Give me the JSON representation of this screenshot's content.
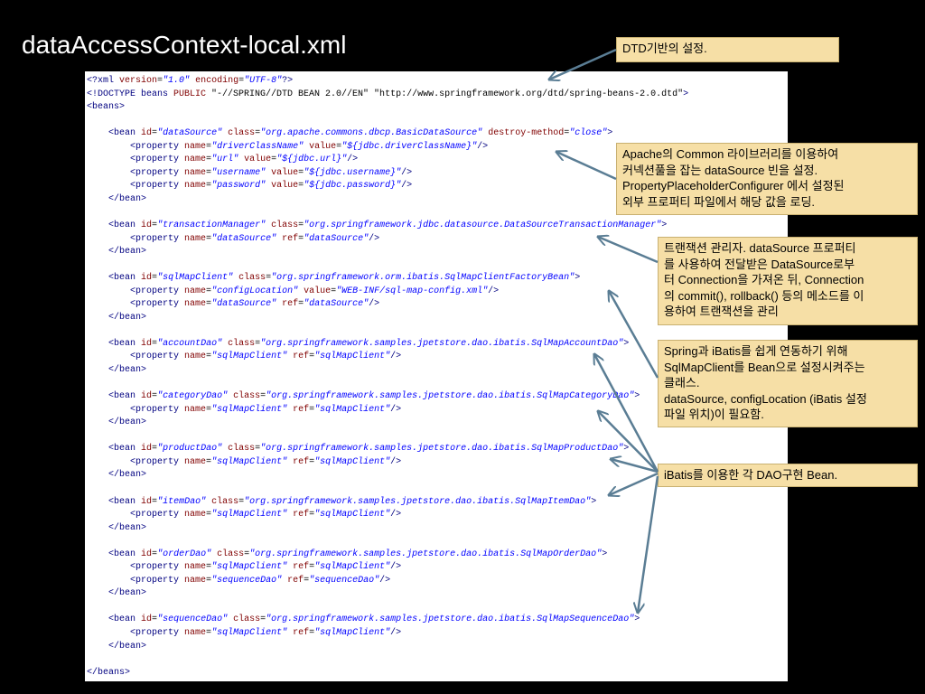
{
  "slide": {
    "title": "dataAccessContext-local.xml"
  },
  "code_lines": [
    [
      [
        "tag",
        "<?xml "
      ],
      [
        "attr",
        "version"
      ],
      [
        "plain",
        "="
      ],
      [
        "val",
        "\"1.0\""
      ],
      [
        "plain",
        " "
      ],
      [
        "attr",
        "encoding"
      ],
      [
        "plain",
        "="
      ],
      [
        "val",
        "\"UTF-8\""
      ],
      [
        "tag",
        "?>"
      ]
    ],
    [
      [
        "tag",
        "<!DOCTYPE beans "
      ],
      [
        "attr",
        "PUBLIC "
      ],
      [
        "plain",
        "\"-//SPRING//DTD BEAN 2.0//EN\" \"http://www.springframework.org/dtd/spring-beans-2.0.dtd\""
      ],
      [
        "tag",
        ">"
      ]
    ],
    [
      [
        "tag",
        "<beans>"
      ]
    ],
    [],
    [
      [
        "plain",
        "    "
      ],
      [
        "tag",
        "<bean "
      ],
      [
        "attr",
        "id"
      ],
      [
        "plain",
        "="
      ],
      [
        "val",
        "\"dataSource\""
      ],
      [
        "plain",
        " "
      ],
      [
        "attr",
        "class"
      ],
      [
        "plain",
        "="
      ],
      [
        "val",
        "\"org.apache.commons.dbcp.BasicDataSource\""
      ],
      [
        "plain",
        " "
      ],
      [
        "attr",
        "destroy-method"
      ],
      [
        "plain",
        "="
      ],
      [
        "val",
        "\"close\""
      ],
      [
        "tag",
        ">"
      ]
    ],
    [
      [
        "plain",
        "        "
      ],
      [
        "tag",
        "<property "
      ],
      [
        "attr",
        "name"
      ],
      [
        "plain",
        "="
      ],
      [
        "val",
        "\"driverClassName\""
      ],
      [
        "plain",
        " "
      ],
      [
        "attr",
        "value"
      ],
      [
        "plain",
        "="
      ],
      [
        "val",
        "\"${jdbc.driverClassName}\""
      ],
      [
        "tag",
        "/>"
      ]
    ],
    [
      [
        "plain",
        "        "
      ],
      [
        "tag",
        "<property "
      ],
      [
        "attr",
        "name"
      ],
      [
        "plain",
        "="
      ],
      [
        "val",
        "\"url\""
      ],
      [
        "plain",
        " "
      ],
      [
        "attr",
        "value"
      ],
      [
        "plain",
        "="
      ],
      [
        "val",
        "\"${jdbc.url}\""
      ],
      [
        "tag",
        "/>"
      ]
    ],
    [
      [
        "plain",
        "        "
      ],
      [
        "tag",
        "<property "
      ],
      [
        "attr",
        "name"
      ],
      [
        "plain",
        "="
      ],
      [
        "val",
        "\"username\""
      ],
      [
        "plain",
        " "
      ],
      [
        "attr",
        "value"
      ],
      [
        "plain",
        "="
      ],
      [
        "val",
        "\"${jdbc.username}\""
      ],
      [
        "tag",
        "/>"
      ]
    ],
    [
      [
        "plain",
        "        "
      ],
      [
        "tag",
        "<property "
      ],
      [
        "attr",
        "name"
      ],
      [
        "plain",
        "="
      ],
      [
        "val",
        "\"password\""
      ],
      [
        "plain",
        " "
      ],
      [
        "attr",
        "value"
      ],
      [
        "plain",
        "="
      ],
      [
        "val",
        "\"${jdbc.password}\""
      ],
      [
        "tag",
        "/>"
      ]
    ],
    [
      [
        "plain",
        "    "
      ],
      [
        "tag",
        "</bean>"
      ]
    ],
    [],
    [
      [
        "plain",
        "    "
      ],
      [
        "tag",
        "<bean "
      ],
      [
        "attr",
        "id"
      ],
      [
        "plain",
        "="
      ],
      [
        "val",
        "\"transactionManager\""
      ],
      [
        "plain",
        " "
      ],
      [
        "attr",
        "class"
      ],
      [
        "plain",
        "="
      ],
      [
        "val",
        "\"org.springframework.jdbc.datasource.DataSourceTransactionManager\""
      ],
      [
        "tag",
        ">"
      ]
    ],
    [
      [
        "plain",
        "        "
      ],
      [
        "tag",
        "<property "
      ],
      [
        "attr",
        "name"
      ],
      [
        "plain",
        "="
      ],
      [
        "val",
        "\"dataSource\""
      ],
      [
        "plain",
        " "
      ],
      [
        "attr",
        "ref"
      ],
      [
        "plain",
        "="
      ],
      [
        "val",
        "\"dataSource\""
      ],
      [
        "tag",
        "/>"
      ]
    ],
    [
      [
        "plain",
        "    "
      ],
      [
        "tag",
        "</bean>"
      ]
    ],
    [],
    [
      [
        "plain",
        "    "
      ],
      [
        "tag",
        "<bean "
      ],
      [
        "attr",
        "id"
      ],
      [
        "plain",
        "="
      ],
      [
        "val",
        "\"sqlMapClient\""
      ],
      [
        "plain",
        " "
      ],
      [
        "attr",
        "class"
      ],
      [
        "plain",
        "="
      ],
      [
        "val",
        "\"org.springframework.orm.ibatis.SqlMapClientFactoryBean\""
      ],
      [
        "tag",
        ">"
      ]
    ],
    [
      [
        "plain",
        "        "
      ],
      [
        "tag",
        "<property "
      ],
      [
        "attr",
        "name"
      ],
      [
        "plain",
        "="
      ],
      [
        "val",
        "\"configLocation\""
      ],
      [
        "plain",
        " "
      ],
      [
        "attr",
        "value"
      ],
      [
        "plain",
        "="
      ],
      [
        "val",
        "\"WEB-INF/sql-map-config.xml\""
      ],
      [
        "tag",
        "/>"
      ]
    ],
    [
      [
        "plain",
        "        "
      ],
      [
        "tag",
        "<property "
      ],
      [
        "attr",
        "name"
      ],
      [
        "plain",
        "="
      ],
      [
        "val",
        "\"dataSource\""
      ],
      [
        "plain",
        " "
      ],
      [
        "attr",
        "ref"
      ],
      [
        "plain",
        "="
      ],
      [
        "val",
        "\"dataSource\""
      ],
      [
        "tag",
        "/>"
      ]
    ],
    [
      [
        "plain",
        "    "
      ],
      [
        "tag",
        "</bean>"
      ]
    ],
    [],
    [
      [
        "plain",
        "    "
      ],
      [
        "tag",
        "<bean "
      ],
      [
        "attr",
        "id"
      ],
      [
        "plain",
        "="
      ],
      [
        "val",
        "\"accountDao\""
      ],
      [
        "plain",
        " "
      ],
      [
        "attr",
        "class"
      ],
      [
        "plain",
        "="
      ],
      [
        "val",
        "\"org.springframework.samples.jpetstore.dao.ibatis.SqlMapAccountDao\""
      ],
      [
        "tag",
        ">"
      ]
    ],
    [
      [
        "plain",
        "        "
      ],
      [
        "tag",
        "<property "
      ],
      [
        "attr",
        "name"
      ],
      [
        "plain",
        "="
      ],
      [
        "val",
        "\"sqlMapClient\""
      ],
      [
        "plain",
        " "
      ],
      [
        "attr",
        "ref"
      ],
      [
        "plain",
        "="
      ],
      [
        "val",
        "\"sqlMapClient\""
      ],
      [
        "tag",
        "/>"
      ]
    ],
    [
      [
        "plain",
        "    "
      ],
      [
        "tag",
        "</bean>"
      ]
    ],
    [],
    [
      [
        "plain",
        "    "
      ],
      [
        "tag",
        "<bean "
      ],
      [
        "attr",
        "id"
      ],
      [
        "plain",
        "="
      ],
      [
        "val",
        "\"categoryDao\""
      ],
      [
        "plain",
        " "
      ],
      [
        "attr",
        "class"
      ],
      [
        "plain",
        "="
      ],
      [
        "val",
        "\"org.springframework.samples.jpetstore.dao.ibatis.SqlMapCategoryDao\""
      ],
      [
        "tag",
        ">"
      ]
    ],
    [
      [
        "plain",
        "        "
      ],
      [
        "tag",
        "<property "
      ],
      [
        "attr",
        "name"
      ],
      [
        "plain",
        "="
      ],
      [
        "val",
        "\"sqlMapClient\""
      ],
      [
        "plain",
        " "
      ],
      [
        "attr",
        "ref"
      ],
      [
        "plain",
        "="
      ],
      [
        "val",
        "\"sqlMapClient\""
      ],
      [
        "tag",
        "/>"
      ]
    ],
    [
      [
        "plain",
        "    "
      ],
      [
        "tag",
        "</bean>"
      ]
    ],
    [],
    [
      [
        "plain",
        "    "
      ],
      [
        "tag",
        "<bean "
      ],
      [
        "attr",
        "id"
      ],
      [
        "plain",
        "="
      ],
      [
        "val",
        "\"productDao\""
      ],
      [
        "plain",
        " "
      ],
      [
        "attr",
        "class"
      ],
      [
        "plain",
        "="
      ],
      [
        "val",
        "\"org.springframework.samples.jpetstore.dao.ibatis.SqlMapProductDao\""
      ],
      [
        "tag",
        ">"
      ]
    ],
    [
      [
        "plain",
        "        "
      ],
      [
        "tag",
        "<property "
      ],
      [
        "attr",
        "name"
      ],
      [
        "plain",
        "="
      ],
      [
        "val",
        "\"sqlMapClient\""
      ],
      [
        "plain",
        " "
      ],
      [
        "attr",
        "ref"
      ],
      [
        "plain",
        "="
      ],
      [
        "val",
        "\"sqlMapClient\""
      ],
      [
        "tag",
        "/>"
      ]
    ],
    [
      [
        "plain",
        "    "
      ],
      [
        "tag",
        "</bean>"
      ]
    ],
    [],
    [
      [
        "plain",
        "    "
      ],
      [
        "tag",
        "<bean "
      ],
      [
        "attr",
        "id"
      ],
      [
        "plain",
        "="
      ],
      [
        "val",
        "\"itemDao\""
      ],
      [
        "plain",
        " "
      ],
      [
        "attr",
        "class"
      ],
      [
        "plain",
        "="
      ],
      [
        "val",
        "\"org.springframework.samples.jpetstore.dao.ibatis.SqlMapItemDao\""
      ],
      [
        "tag",
        ">"
      ]
    ],
    [
      [
        "plain",
        "        "
      ],
      [
        "tag",
        "<property "
      ],
      [
        "attr",
        "name"
      ],
      [
        "plain",
        "="
      ],
      [
        "val",
        "\"sqlMapClient\""
      ],
      [
        "plain",
        " "
      ],
      [
        "attr",
        "ref"
      ],
      [
        "plain",
        "="
      ],
      [
        "val",
        "\"sqlMapClient\""
      ],
      [
        "tag",
        "/>"
      ]
    ],
    [
      [
        "plain",
        "    "
      ],
      [
        "tag",
        "</bean>"
      ]
    ],
    [],
    [
      [
        "plain",
        "    "
      ],
      [
        "tag",
        "<bean "
      ],
      [
        "attr",
        "id"
      ],
      [
        "plain",
        "="
      ],
      [
        "val",
        "\"orderDao\""
      ],
      [
        "plain",
        " "
      ],
      [
        "attr",
        "class"
      ],
      [
        "plain",
        "="
      ],
      [
        "val",
        "\"org.springframework.samples.jpetstore.dao.ibatis.SqlMapOrderDao\""
      ],
      [
        "tag",
        ">"
      ]
    ],
    [
      [
        "plain",
        "        "
      ],
      [
        "tag",
        "<property "
      ],
      [
        "attr",
        "name"
      ],
      [
        "plain",
        "="
      ],
      [
        "val",
        "\"sqlMapClient\""
      ],
      [
        "plain",
        " "
      ],
      [
        "attr",
        "ref"
      ],
      [
        "plain",
        "="
      ],
      [
        "val",
        "\"sqlMapClient\""
      ],
      [
        "tag",
        "/>"
      ]
    ],
    [
      [
        "plain",
        "        "
      ],
      [
        "tag",
        "<property "
      ],
      [
        "attr",
        "name"
      ],
      [
        "plain",
        "="
      ],
      [
        "val",
        "\"sequenceDao\""
      ],
      [
        "plain",
        " "
      ],
      [
        "attr",
        "ref"
      ],
      [
        "plain",
        "="
      ],
      [
        "val",
        "\"sequenceDao\""
      ],
      [
        "tag",
        "/>"
      ]
    ],
    [
      [
        "plain",
        "    "
      ],
      [
        "tag",
        "</bean>"
      ]
    ],
    [],
    [
      [
        "plain",
        "    "
      ],
      [
        "tag",
        "<bean "
      ],
      [
        "attr",
        "id"
      ],
      [
        "plain",
        "="
      ],
      [
        "val",
        "\"sequenceDao\""
      ],
      [
        "plain",
        " "
      ],
      [
        "attr",
        "class"
      ],
      [
        "plain",
        "="
      ],
      [
        "val",
        "\"org.springframework.samples.jpetstore.dao.ibatis.SqlMapSequenceDao\""
      ],
      [
        "tag",
        ">"
      ]
    ],
    [
      [
        "plain",
        "        "
      ],
      [
        "tag",
        "<property "
      ],
      [
        "attr",
        "name"
      ],
      [
        "plain",
        "="
      ],
      [
        "val",
        "\"sqlMapClient\""
      ],
      [
        "plain",
        " "
      ],
      [
        "attr",
        "ref"
      ],
      [
        "plain",
        "="
      ],
      [
        "val",
        "\"sqlMapClient\""
      ],
      [
        "tag",
        "/>"
      ]
    ],
    [
      [
        "plain",
        "    "
      ],
      [
        "tag",
        "</bean>"
      ]
    ],
    [],
    [
      [
        "tag",
        "</beans>"
      ]
    ]
  ],
  "callouts": {
    "dtd": {
      "lines": [
        "DTD기반의 설정."
      ]
    },
    "datasource": {
      "lines": [
        "Apache의 Common 라이브러리를 이용하여",
        "커넥션풀을 잡는 dataSource 빈을 설정.",
        "PropertyPlaceholderConfigurer 에서 설정된",
        "외부 프로퍼티 파일에서 해당 값을 로딩."
      ]
    },
    "transaction": {
      "lines": [
        "트랜잭션 관리자. dataSource 프로퍼티",
        "를 사용하여 전달받은 DataSource로부",
        "터 Connection을 가져온 뒤, Connection",
        "의 commit(), rollback() 등의 메소드를 이",
        "용하여 트랜잭션을 관리"
      ]
    },
    "sqlmap": {
      "lines": [
        "Spring과 iBatis를 쉽게 연동하기 위해",
        "SqlMapClient를 Bean으로 설정시켜주는",
        "클래스.",
        "dataSource, configLocation (iBatis 설정",
        "파일 위치)이 필요함."
      ]
    },
    "dao": {
      "lines": [
        "iBatis를 이용한 각 DAO구현 Bean."
      ]
    }
  },
  "colors": {
    "background": "#000000",
    "callout_fill": "#f6dfa6",
    "arrow": "#5a7d94",
    "xml_tag": "#000080",
    "xml_attr": "#800000",
    "xml_value": "#0000ff"
  }
}
